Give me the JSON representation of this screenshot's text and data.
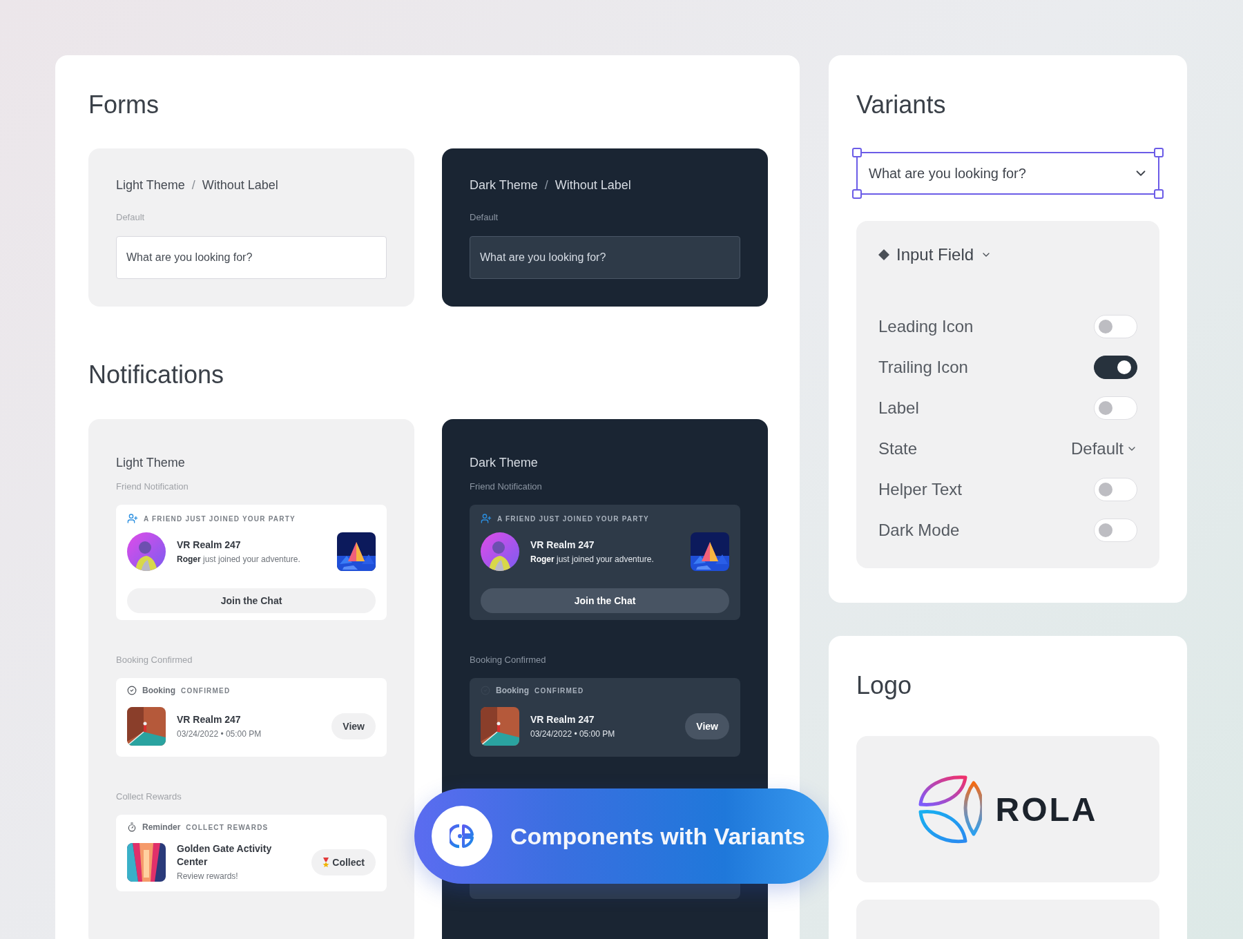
{
  "forms": {
    "title": "Forms",
    "cards": [
      {
        "dark": false,
        "breadcrumb": [
          "Light Theme",
          "Without Label"
        ],
        "separator": "/",
        "state_label": "Default",
        "placeholder": "What are you looking for?"
      },
      {
        "dark": true,
        "breadcrumb": [
          "Dark Theme",
          "Without Label"
        ],
        "separator": "/",
        "state_label": "Default",
        "placeholder": "What are you looking for?"
      }
    ]
  },
  "notifications": {
    "title": "Notifications",
    "columns": [
      {
        "dark": false,
        "title": "Light Theme",
        "sections": [
          {
            "kind": "friend",
            "label": "Friend Notification",
            "tag": "A FRIEND JUST JOINED YOUR PARTY",
            "title": "VR Realm 247",
            "message": "**Roger** just joined your adventure.",
            "button": "Join the Chat"
          },
          {
            "kind": "booking",
            "label": "Booking Confirmed",
            "type": "Booking",
            "tag": "CONFIRMED",
            "title": "VR Realm 247",
            "message": "03/24/2022 • 05:00 PM",
            "button": "View"
          },
          {
            "kind": "reward",
            "label": "Collect Rewards",
            "type": "Reminder",
            "tag": "COLLECT REWARDS",
            "title": "Golden Gate Activity Center",
            "message": "Review rewards!",
            "button": "Collect"
          }
        ]
      },
      {
        "dark": true,
        "title": "Dark Theme",
        "sections": [
          {
            "kind": "friend",
            "label": "Friend Notification",
            "tag": "A FRIEND JUST JOINED YOUR PARTY",
            "title": "VR Realm 247",
            "message": "**Roger** just joined your adventure.",
            "button": "Join the Chat"
          },
          {
            "kind": "booking",
            "label": "Booking Confirmed",
            "type": "Booking",
            "tag": "CONFIRMED",
            "title": "VR Realm 247",
            "message": "03/24/2022 • 05:00 PM",
            "button": "View"
          },
          {
            "kind": "covered"
          }
        ]
      }
    ]
  },
  "variants": {
    "title": "Variants",
    "field": {
      "placeholder": "What are you looking for?",
      "selected": true
    },
    "panel": {
      "title": "Input Field",
      "properties": [
        {
          "kind": "toggle",
          "label": "Leading Icon",
          "on": false
        },
        {
          "kind": "toggle",
          "label": "Trailing Icon",
          "on": true
        },
        {
          "kind": "toggle",
          "label": "Label",
          "on": false
        },
        {
          "kind": "select",
          "label": "State",
          "value": "Default"
        },
        {
          "kind": "toggle",
          "label": "Helper Text",
          "on": false
        },
        {
          "kind": "toggle",
          "label": "Dark Mode",
          "on": false
        }
      ]
    }
  },
  "logo": {
    "title": "Logo",
    "wordmark": "ROLA"
  },
  "banner": {
    "text": "Components with Variants"
  }
}
